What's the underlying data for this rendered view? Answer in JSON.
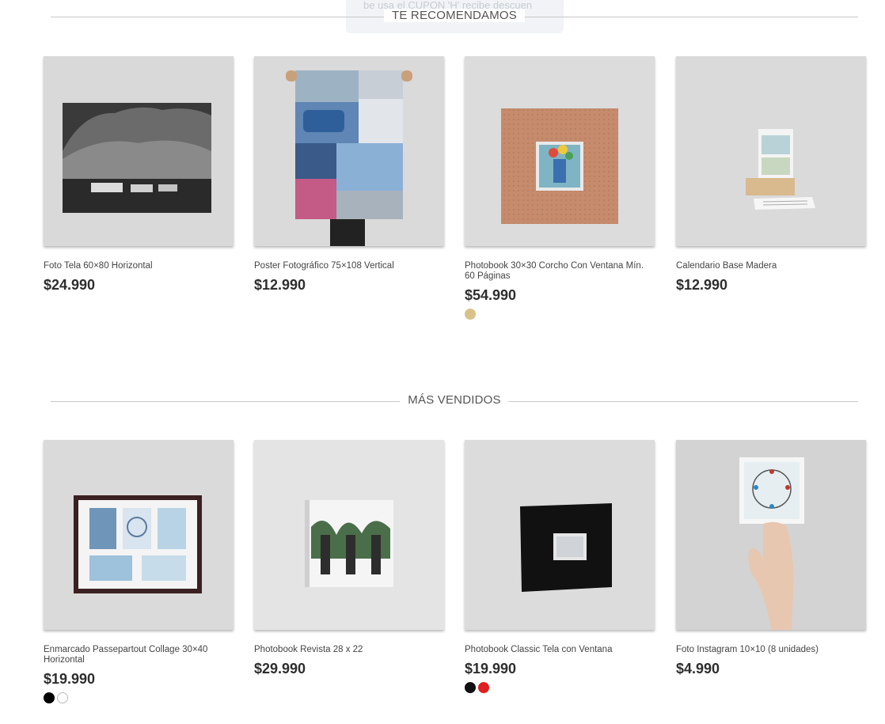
{
  "toast": {
    "text": "be usa el CUPON 'H' recibe descuen"
  },
  "sections": [
    {
      "title": "TE RECOMENDAMOS",
      "products": [
        {
          "name": "Foto Tela 60×80 Horizontal",
          "price": "$24.990",
          "swatches": []
        },
        {
          "name": "Poster Fotográfico 75×108 Vertical",
          "price": "$12.990",
          "swatches": []
        },
        {
          "name": "Photobook 30×30 Corcho Con Ventana Mín. 60 Páginas",
          "price": "$54.990",
          "swatches": [
            "#d9c28a"
          ]
        },
        {
          "name": "Calendario Base Madera",
          "price": "$12.990",
          "swatches": []
        }
      ]
    },
    {
      "title": "MÁS VENDIDOS",
      "products": [
        {
          "name": "Enmarcado Passepartout Collage 30×40 Horizontal",
          "price": "$19.990",
          "swatches": [
            "#000000",
            "#ffffff"
          ]
        },
        {
          "name": "Photobook Revista 28 x 22",
          "price": "$29.990",
          "swatches": []
        },
        {
          "name": "Photobook Classic Tela con Ventana",
          "price": "$19.990",
          "swatches": [
            "#111111",
            "#e02020"
          ]
        },
        {
          "name": "Foto Instagram 10×10 (8 unidades)",
          "price": "$4.990",
          "swatches": []
        }
      ]
    }
  ]
}
